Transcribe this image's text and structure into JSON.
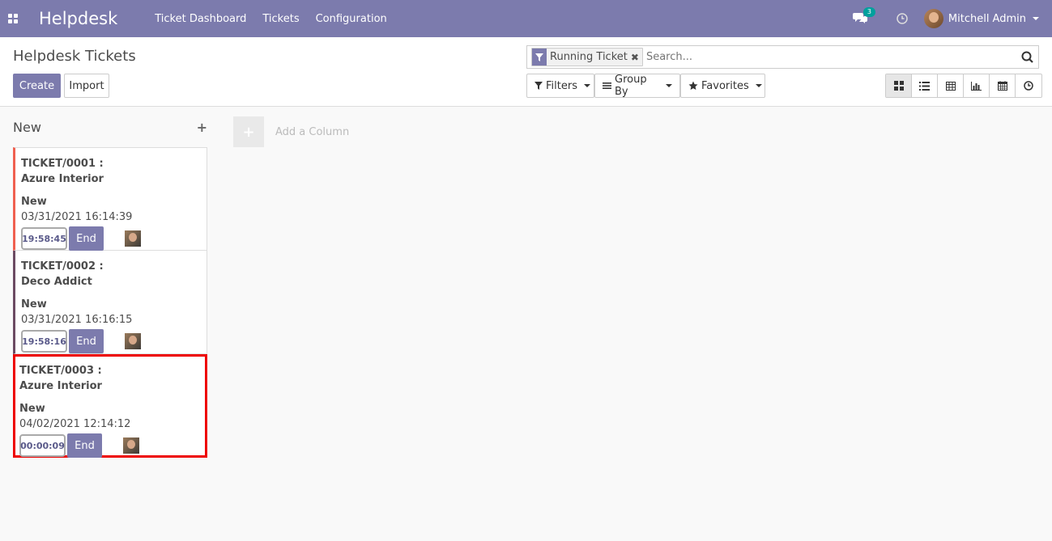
{
  "navbar": {
    "brand": "Helpdesk",
    "menu": [
      "Ticket Dashboard",
      "Tickets",
      "Configuration"
    ],
    "chat_badge": "3",
    "user_name": "Mitchell Admin"
  },
  "control": {
    "title": "Helpdesk Tickets",
    "create_label": "Create",
    "import_label": "Import",
    "search": {
      "facet_label": "Running Ticket",
      "placeholder": "Search..."
    },
    "filters_label": "Filters",
    "groupby_label": "Group By",
    "favorites_label": "Favorites",
    "views": [
      "kanban-icon",
      "list-icon",
      "pivot-icon",
      "graph-icon",
      "calendar-icon",
      "activity-icon"
    ]
  },
  "kanban": {
    "column_title": "New",
    "add_column_label": "Add a Column",
    "cards": [
      {
        "ref": "TICKET/0001 :",
        "partner": "Azure Interior",
        "stage": "New",
        "date": "03/31/2021 16:14:39",
        "timer": "19:58:45",
        "end_label": "End"
      },
      {
        "ref": "TICKET/0002 :",
        "partner": "Deco Addict",
        "stage": "New",
        "date": "03/31/2021 16:16:15",
        "timer": "19:58:16",
        "end_label": "End"
      },
      {
        "ref": "TICKET/0003 :",
        "partner": "Azure Interior",
        "stage": "New",
        "date": "04/02/2021 12:14:12",
        "timer": "00:00:09",
        "end_label": "End"
      }
    ]
  },
  "colors": {
    "brand": "#7c7bad",
    "card1_accent": "#f06050",
    "card2_accent": "#6c4b63",
    "highlight": "#ee0000",
    "badge": "#00a09d"
  }
}
